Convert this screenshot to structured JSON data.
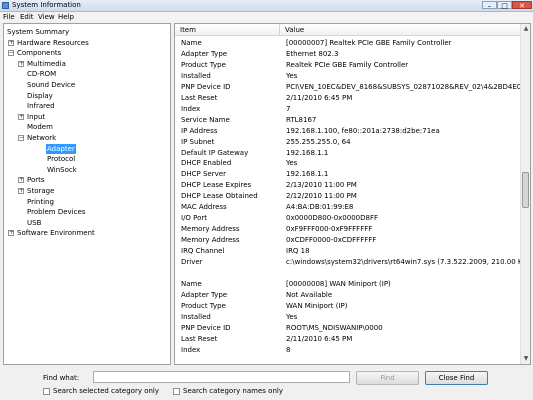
{
  "window": {
    "title": "System Information"
  },
  "menu": [
    "File",
    "Edit",
    "View",
    "Help"
  ],
  "tree": [
    {
      "label": "System Summary",
      "toggle": "",
      "depth": 0
    },
    {
      "label": "Hardware Resources",
      "toggle": "+",
      "depth": 1
    },
    {
      "label": "Components",
      "toggle": "−",
      "depth": 1
    },
    {
      "label": "Multimedia",
      "toggle": "+",
      "depth": 2
    },
    {
      "label": "CD-ROM",
      "toggle": "",
      "depth": 2
    },
    {
      "label": "Sound Device",
      "toggle": "",
      "depth": 2
    },
    {
      "label": "Display",
      "toggle": "",
      "depth": 2
    },
    {
      "label": "Infrared",
      "toggle": "",
      "depth": 2
    },
    {
      "label": "Input",
      "toggle": "+",
      "depth": 2
    },
    {
      "label": "Modem",
      "toggle": "",
      "depth": 2
    },
    {
      "label": "Network",
      "toggle": "−",
      "depth": 2
    },
    {
      "label": "Adapter",
      "toggle": "",
      "depth": 3,
      "selected": true
    },
    {
      "label": "Protocol",
      "toggle": "",
      "depth": 3
    },
    {
      "label": "WinSock",
      "toggle": "",
      "depth": 3
    },
    {
      "label": "Ports",
      "toggle": "+",
      "depth": 2
    },
    {
      "label": "Storage",
      "toggle": "+",
      "depth": 2
    },
    {
      "label": "Printing",
      "toggle": "",
      "depth": 2
    },
    {
      "label": "Problem Devices",
      "toggle": "",
      "depth": 2
    },
    {
      "label": "USB",
      "toggle": "",
      "depth": 2
    },
    {
      "label": "Software Environment",
      "toggle": "+",
      "depth": 1
    }
  ],
  "columns": {
    "item": "Item",
    "value": "Value"
  },
  "rows": [
    {
      "item": "Name",
      "value": "[00000007] Realtek PCIe GBE Family Controller"
    },
    {
      "item": "Adapter Type",
      "value": "Ethernet 802.3"
    },
    {
      "item": "Product Type",
      "value": "Realtek PCIe GBE Family Controller"
    },
    {
      "item": "Installed",
      "value": "Yes"
    },
    {
      "item": "PNP Device ID",
      "value": "PCI\\VEN_10EC&DEV_8168&SUBSYS_02871028&REV_02\\4&2BD4E0B8&0&00E2"
    },
    {
      "item": "Last Reset",
      "value": "2/11/2010 6:45 PM"
    },
    {
      "item": "Index",
      "value": "7"
    },
    {
      "item": "Service Name",
      "value": "RTL8167"
    },
    {
      "item": "IP Address",
      "value": "192.168.1.100, fe80::201a:2738:d2be:71ea"
    },
    {
      "item": "IP Subnet",
      "value": "255.255.255.0, 64"
    },
    {
      "item": "Default IP Gateway",
      "value": "192.168.1.1"
    },
    {
      "item": "DHCP Enabled",
      "value": "Yes"
    },
    {
      "item": "DHCP Server",
      "value": "192.168.1.1"
    },
    {
      "item": "DHCP Lease Expires",
      "value": "2/13/2010 11:00 PM"
    },
    {
      "item": "DHCP Lease Obtained",
      "value": "2/12/2010 11:00 PM"
    },
    {
      "item": "MAC Address",
      "value": "A4:BA:DB:01:99:E8"
    },
    {
      "item": "I/O Port",
      "value": "0x0000D800-0x0000D8FF"
    },
    {
      "item": "Memory Address",
      "value": "0xF9FFF000-0xF9FFFFFF"
    },
    {
      "item": "Memory Address",
      "value": "0xCDFF0000-0xCDFFFFFF"
    },
    {
      "item": "IRQ Channel",
      "value": "IRQ 18"
    },
    {
      "item": "Driver",
      "value": "c:\\windows\\system32\\drivers\\rt64win7.sys (7.3.522.2009, 210.00 KB (215,040 b"
    },
    {
      "item": "",
      "value": ""
    },
    {
      "item": "Name",
      "value": "[00000008] WAN Miniport (IP)"
    },
    {
      "item": "Adapter Type",
      "value": "Not Available"
    },
    {
      "item": "Product Type",
      "value": "WAN Miniport (IP)"
    },
    {
      "item": "Installed",
      "value": "Yes"
    },
    {
      "item": "PNP Device ID",
      "value": "ROOT\\MS_NDISWANIP\\0000"
    },
    {
      "item": "Last Reset",
      "value": "2/11/2010 6:45 PM"
    },
    {
      "item": "Index",
      "value": "8"
    }
  ],
  "find": {
    "label": "Find what:",
    "value": "",
    "find_button": "Find",
    "close_button": "Close Find",
    "checkbox1": "Search selected category only",
    "checkbox2": "Search category names only"
  }
}
